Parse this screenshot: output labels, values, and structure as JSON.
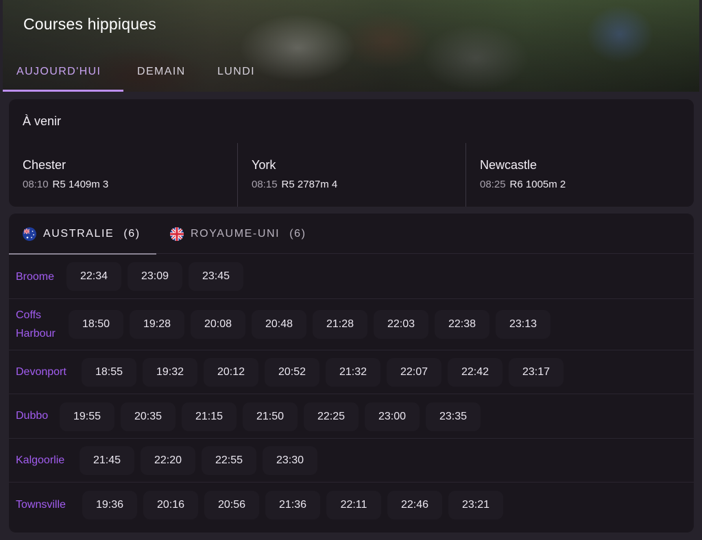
{
  "header": {
    "title": "Courses hippiques",
    "tabs": [
      {
        "label": "AUJOURD'HUI",
        "active": true
      },
      {
        "label": "DEMAIN",
        "active": false
      },
      {
        "label": "LUNDI",
        "active": false
      }
    ]
  },
  "upcoming": {
    "title": "À venir",
    "races": [
      {
        "venue": "Chester",
        "time": "08:10",
        "race": "R5 1409m 3"
      },
      {
        "venue": "York",
        "time": "08:15",
        "race": "R5 2787m 4"
      },
      {
        "venue": "Newcastle",
        "time": "08:25",
        "race": "R6 1005m 2"
      }
    ]
  },
  "countries": [
    {
      "name": "AUSTRALIE",
      "count": "(6)",
      "flag": "australia-flag-icon",
      "active": true
    },
    {
      "name": "ROYAUME-UNI",
      "count": "(6)",
      "flag": "uk-flag-icon",
      "active": false
    }
  ],
  "venues": [
    {
      "name": "Broome",
      "times": [
        "22:34",
        "23:09",
        "23:45"
      ]
    },
    {
      "name": "Coffs Harbour",
      "times": [
        "18:50",
        "19:28",
        "20:08",
        "20:48",
        "21:28",
        "22:03",
        "22:38",
        "23:13"
      ]
    },
    {
      "name": "Devonport",
      "times": [
        "18:55",
        "19:32",
        "20:12",
        "20:52",
        "21:32",
        "22:07",
        "22:42",
        "23:17"
      ]
    },
    {
      "name": "Dubbo",
      "times": [
        "19:55",
        "20:35",
        "21:15",
        "21:50",
        "22:25",
        "23:00",
        "23:35"
      ]
    },
    {
      "name": "Kalgoorlie",
      "times": [
        "21:45",
        "22:20",
        "22:55",
        "23:30"
      ]
    },
    {
      "name": "Townsville",
      "times": [
        "19:36",
        "20:16",
        "20:56",
        "21:36",
        "22:11",
        "22:46",
        "23:21"
      ]
    }
  ],
  "colors": {
    "accent": "#bd8ff0",
    "venue_link": "#a25df0",
    "card_bg": "#1a161d",
    "page_bg": "#26222b"
  }
}
